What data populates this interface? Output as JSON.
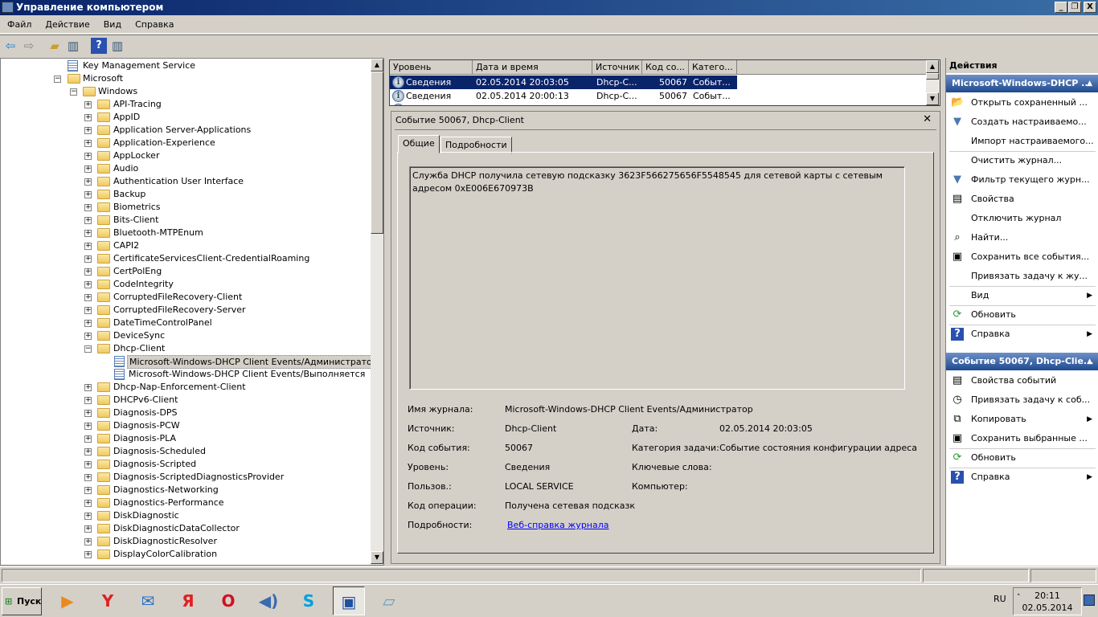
{
  "window": {
    "title": "Управление компьютером",
    "min": "_",
    "restore": "❐",
    "close": "X"
  },
  "menu": [
    "Файл",
    "Действие",
    "Вид",
    "Справка"
  ],
  "tree": [
    {
      "label": "Key Management Service",
      "level": 1,
      "icon": "event-log-icon",
      "expander": ""
    },
    {
      "label": "Microsoft",
      "level": 1,
      "icon": "folder-icon",
      "expander": "−"
    },
    {
      "label": "Windows",
      "level": 2,
      "icon": "folder-icon",
      "expander": "−"
    },
    {
      "label": "API-Tracing",
      "level": 3,
      "icon": "folder-icon",
      "expander": "+"
    },
    {
      "label": "AppID",
      "level": 3,
      "icon": "folder-icon",
      "expander": "+"
    },
    {
      "label": "Application Server-Applications",
      "level": 3,
      "icon": "folder-icon",
      "expander": "+"
    },
    {
      "label": "Application-Experience",
      "level": 3,
      "icon": "folder-icon",
      "expander": "+"
    },
    {
      "label": "AppLocker",
      "level": 3,
      "icon": "folder-icon",
      "expander": "+"
    },
    {
      "label": "Audio",
      "level": 3,
      "icon": "folder-icon",
      "expander": "+"
    },
    {
      "label": "Authentication User Interface",
      "level": 3,
      "icon": "folder-icon",
      "expander": "+"
    },
    {
      "label": "Backup",
      "level": 3,
      "icon": "folder-icon",
      "expander": "+"
    },
    {
      "label": "Biometrics",
      "level": 3,
      "icon": "folder-icon",
      "expander": "+"
    },
    {
      "label": "Bits-Client",
      "level": 3,
      "icon": "folder-icon",
      "expander": "+"
    },
    {
      "label": "Bluetooth-MTPEnum",
      "level": 3,
      "icon": "folder-icon",
      "expander": "+"
    },
    {
      "label": "CAPI2",
      "level": 3,
      "icon": "folder-icon",
      "expander": "+"
    },
    {
      "label": "CertificateServicesClient-CredentialRoaming",
      "level": 3,
      "icon": "folder-icon",
      "expander": "+"
    },
    {
      "label": "CertPolEng",
      "level": 3,
      "icon": "folder-icon",
      "expander": "+"
    },
    {
      "label": "CodeIntegrity",
      "level": 3,
      "icon": "folder-icon",
      "expander": "+"
    },
    {
      "label": "CorruptedFileRecovery-Client",
      "level": 3,
      "icon": "folder-icon",
      "expander": "+"
    },
    {
      "label": "CorruptedFileRecovery-Server",
      "level": 3,
      "icon": "folder-icon",
      "expander": "+"
    },
    {
      "label": "DateTimeControlPanel",
      "level": 3,
      "icon": "folder-icon",
      "expander": "+"
    },
    {
      "label": "DeviceSync",
      "level": 3,
      "icon": "folder-icon",
      "expander": "+"
    },
    {
      "label": "Dhcp-Client",
      "level": 3,
      "icon": "folder-icon",
      "expander": "−"
    },
    {
      "label": "Microsoft-Windows-DHCP Client Events/Администратор",
      "level": 4,
      "icon": "log-icon",
      "expander": "",
      "selected": true
    },
    {
      "label": "Microsoft-Windows-DHCP Client Events/Выполняется",
      "level": 4,
      "icon": "log-icon",
      "expander": ""
    },
    {
      "label": "Dhcp-Nap-Enforcement-Client",
      "level": 3,
      "icon": "folder-icon",
      "expander": "+"
    },
    {
      "label": "DHCPv6-Client",
      "level": 3,
      "icon": "folder-icon",
      "expander": "+"
    },
    {
      "label": "Diagnosis-DPS",
      "level": 3,
      "icon": "folder-icon",
      "expander": "+"
    },
    {
      "label": "Diagnosis-PCW",
      "level": 3,
      "icon": "folder-icon",
      "expander": "+"
    },
    {
      "label": "Diagnosis-PLA",
      "level": 3,
      "icon": "folder-icon",
      "expander": "+"
    },
    {
      "label": "Diagnosis-Scheduled",
      "level": 3,
      "icon": "folder-icon",
      "expander": "+"
    },
    {
      "label": "Diagnosis-Scripted",
      "level": 3,
      "icon": "folder-icon",
      "expander": "+"
    },
    {
      "label": "Diagnosis-ScriptedDiagnosticsProvider",
      "level": 3,
      "icon": "folder-icon",
      "expander": "+"
    },
    {
      "label": "Diagnostics-Networking",
      "level": 3,
      "icon": "folder-icon",
      "expander": "+"
    },
    {
      "label": "Diagnostics-Performance",
      "level": 3,
      "icon": "folder-icon",
      "expander": "+"
    },
    {
      "label": "DiskDiagnostic",
      "level": 3,
      "icon": "folder-icon",
      "expander": "+"
    },
    {
      "label": "DiskDiagnosticDataCollector",
      "level": 3,
      "icon": "folder-icon",
      "expander": "+"
    },
    {
      "label": "DiskDiagnosticResolver",
      "level": 3,
      "icon": "folder-icon",
      "expander": "+"
    },
    {
      "label": "DisplayColorCalibration",
      "level": 3,
      "icon": "folder-icon",
      "expander": "+"
    }
  ],
  "events": {
    "columns": [
      "Уровень",
      "Дата и время",
      "Источник",
      "Код со...",
      "Катего..."
    ],
    "rows": [
      {
        "level": "Сведения",
        "datetime": "02.05.2014 20:03:05",
        "source": "Dhcp-C...",
        "code": "50067",
        "category": "Событ...",
        "selected": true
      },
      {
        "level": "Сведения",
        "datetime": "02.05.2014 20:00:13",
        "source": "Dhcp-C...",
        "code": "50067",
        "category": "Событ..."
      }
    ]
  },
  "detail": {
    "title": "Событие 50067, Dhcp-Client",
    "close": "✕",
    "tabs": [
      "Общие",
      "Подробности"
    ],
    "message": "Служба DHCP получила сетевую подсказку 3623F566275656F5548545 для сетевой карты с сетевым адресом 0xE006E670973B",
    "fields": {
      "log_name_label": "Имя журнала:",
      "log_name": "Microsoft-Windows-DHCP Client Events/Администратор",
      "source_label": "Источник:",
      "source": "Dhcp-Client",
      "date_label": "Дата:",
      "date": "02.05.2014 20:03:05",
      "event_id_label": "Код события:",
      "event_id": "50067",
      "task_label": "Категория задачи:",
      "task": "Событие состояния конфигурации адреса",
      "level_label": "Уровень:",
      "level": "Сведения",
      "keywords_label": "Ключевые слова:",
      "user_label": "Пользов.:",
      "user": "LOCAL SERVICE",
      "computer_label": "Компьютер:",
      "opcode_label": "Код операции:",
      "opcode": "Получена сетевая подсказк",
      "more_label": "Подробности:",
      "more_link": "Веб-справка журнала"
    }
  },
  "actions": {
    "title": "Действия",
    "group1": "Microsoft-Windows-DHCP ...",
    "items1": [
      {
        "label": "Открыть сохраненный ...",
        "icon": "open-folder-icon",
        "glyph": "📂"
      },
      {
        "label": "Создать настраиваемо...",
        "icon": "filter-new-icon",
        "glyph": "▼"
      },
      {
        "label": "Импорт настраиваемого...",
        "icon": "",
        "glyph": "",
        "sep": true
      },
      {
        "label": "Очистить журнал...",
        "icon": "",
        "glyph": ""
      },
      {
        "label": "Фильтр текущего журн...",
        "icon": "filter-icon",
        "glyph": "▼"
      },
      {
        "label": "Свойства",
        "icon": "properties-icon",
        "glyph": "▤"
      },
      {
        "label": "Отключить журнал",
        "icon": "",
        "glyph": ""
      },
      {
        "label": "Найти...",
        "icon": "binoculars-icon",
        "glyph": "⌕"
      },
      {
        "label": "Сохранить все события...",
        "icon": "save-icon",
        "glyph": "▣"
      },
      {
        "label": "Привязать задачу к жу...",
        "icon": "",
        "glyph": "",
        "sep": true
      },
      {
        "label": "Вид",
        "icon": "",
        "glyph": "",
        "sub": true,
        "sep": true
      },
      {
        "label": "Обновить",
        "icon": "refresh-icon",
        "glyph": "⟳",
        "sep": true
      },
      {
        "label": "Справка",
        "icon": "help-icon",
        "glyph": "?",
        "sub": true
      }
    ],
    "group2": "Событие 50067, Dhcp-Clie...",
    "items2": [
      {
        "label": "Свойства событий",
        "icon": "event-properties-icon",
        "glyph": "▤"
      },
      {
        "label": "Привязать задачу к соб...",
        "icon": "task-clock-icon",
        "glyph": "◷"
      },
      {
        "label": "Копировать",
        "icon": "copy-icon",
        "glyph": "⧉",
        "sub": true
      },
      {
        "label": "Сохранить выбранные ...",
        "icon": "save-icon",
        "glyph": "▣",
        "sep": true
      },
      {
        "label": "Обновить",
        "icon": "refresh-icon",
        "glyph": "⟳",
        "sep": true
      },
      {
        "label": "Справка",
        "icon": "help-icon",
        "glyph": "?",
        "sub": true
      }
    ]
  },
  "taskbar": {
    "start": "Пуск",
    "lang": "RU",
    "time": "20:11",
    "date": "02.05.2014",
    "apps": [
      {
        "name": "media-player-icon",
        "glyph": "▶",
        "color": "#e88a20"
      },
      {
        "name": "yandex-browser-icon",
        "glyph": "Y",
        "color": "#e02020"
      },
      {
        "name": "mail-icon",
        "glyph": "✉",
        "color": "#2a70c0"
      },
      {
        "name": "yandex-icon",
        "glyph": "Я",
        "color": "#e02020"
      },
      {
        "name": "opera-icon",
        "glyph": "O",
        "color": "#d01020"
      },
      {
        "name": "sound-icon",
        "glyph": "◀)",
        "color": "#3a6ab0"
      },
      {
        "name": "skype-icon",
        "glyph": "S",
        "color": "#00a0e0"
      },
      {
        "name": "computer-management-icon",
        "glyph": "▣",
        "color": "#2050a0"
      },
      {
        "name": "notepad-icon",
        "glyph": "▱",
        "color": "#60a0c0"
      }
    ]
  }
}
